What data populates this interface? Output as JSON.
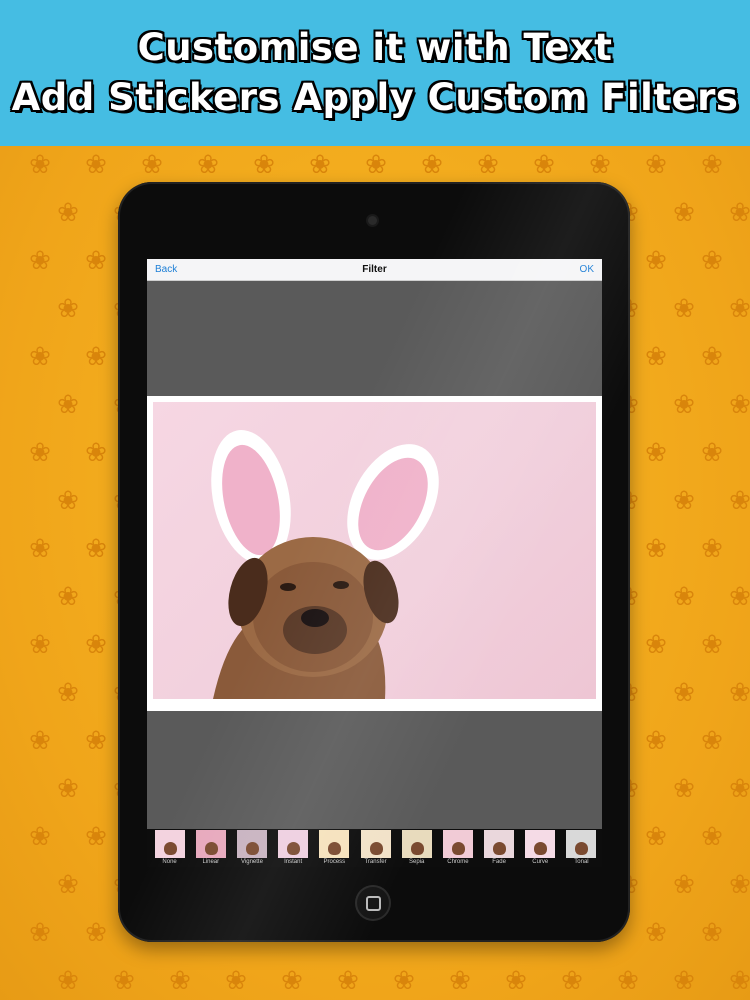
{
  "banner": {
    "line1": "Customise it with Text",
    "line2": "Add Stickers Apply Custom Filters"
  },
  "navbar": {
    "back_label": "Back",
    "title": "Filter",
    "ok_label": "OK"
  },
  "filters": [
    {
      "label": "None",
      "tint": "#f3d3df"
    },
    {
      "label": "Linear",
      "tint": "#e7a9bd"
    },
    {
      "label": "Vignette",
      "tint": "#c8b3c0"
    },
    {
      "label": "Instant",
      "tint": "#eecfe0"
    },
    {
      "label": "Process",
      "tint": "#f6e2bd"
    },
    {
      "label": "Transfer",
      "tint": "#f2e2c8"
    },
    {
      "label": "Sepia",
      "tint": "#e8dbbd"
    },
    {
      "label": "Chrome",
      "tint": "#f1cbd6"
    },
    {
      "label": "Fade",
      "tint": "#ead7dc"
    },
    {
      "label": "Curve",
      "tint": "#f5dbe6"
    },
    {
      "label": "Tonal",
      "tint": "#d9d9d9"
    }
  ],
  "colors": {
    "banner_bg": "#45bde3",
    "background": "#f4ae1c",
    "tablet": "#0c0c0c",
    "accent_link": "#1e7fd6"
  },
  "icons": [
    "camera-icon",
    "home-button-icon",
    "motif-icon"
  ]
}
